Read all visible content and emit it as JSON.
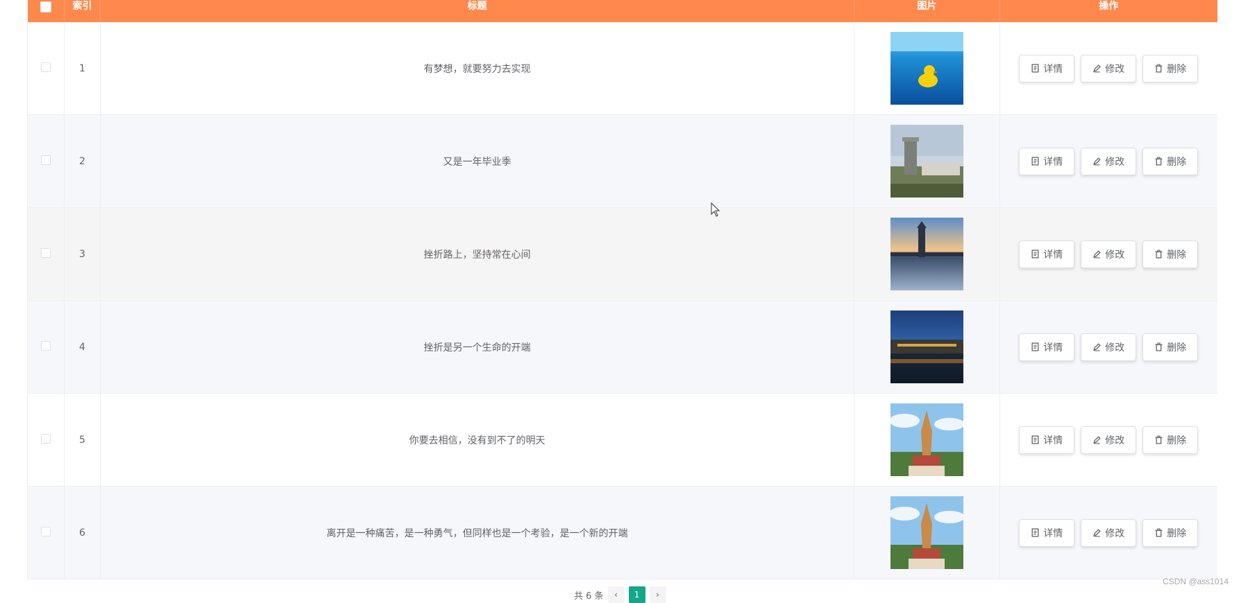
{
  "table": {
    "header": {
      "index": "索引",
      "title": "标题",
      "image": "图片",
      "actions": "操作"
    },
    "header_color": "#ff884d",
    "rows": [
      {
        "index": "1",
        "title": "有梦想，就要努力去实现"
      },
      {
        "index": "2",
        "title": "又是一年毕业季"
      },
      {
        "index": "3",
        "title": "挫折路上，坚持常在心间"
      },
      {
        "index": "4",
        "title": "挫折是另一个生命的开端"
      },
      {
        "index": "5",
        "title": "你要去相信，没有到不了的明天"
      },
      {
        "index": "6",
        "title": "离开是一种痛苦，是一种勇气，但同样也是一个考验，是一个新的开端"
      }
    ],
    "buttons": {
      "detail": "详情",
      "edit": "修改",
      "delete": "删除"
    }
  },
  "pagination": {
    "total_label": "共 6 条",
    "current_page": "1",
    "active_color": "#13a689"
  },
  "watermark": "CSDN @ass1014"
}
